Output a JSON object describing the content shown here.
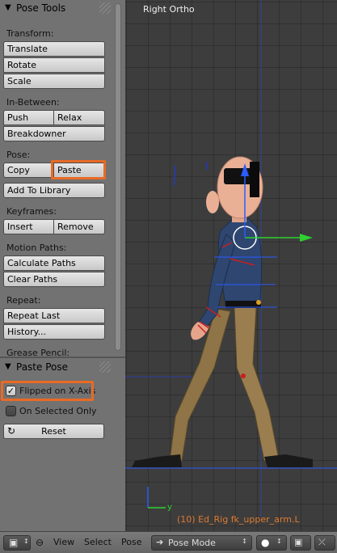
{
  "toolshelf": {
    "title": "Pose Tools",
    "sections": {
      "transform": "Transform:",
      "in_between": "In-Between:",
      "pose": "Pose:",
      "keyframes": "Keyframes:",
      "motion_paths": "Motion Paths:",
      "repeat": "Repeat:",
      "grease_pencil": "Grease Pencil:"
    },
    "buttons": {
      "translate": "Translate",
      "rotate": "Rotate",
      "scale": "Scale",
      "push": "Push",
      "relax": "Relax",
      "breakdowner": "Breakdowner",
      "copy": "Copy",
      "paste": "Paste",
      "add_to_library": "Add To Library",
      "insert": "Insert",
      "remove": "Remove",
      "calculate_paths": "Calculate Paths",
      "clear_paths": "Clear Paths",
      "repeat_last": "Repeat Last",
      "history": "History..."
    }
  },
  "paste_pose": {
    "title": "Paste Pose",
    "flipped_label": "Flipped on X-Axis",
    "flipped_checked": true,
    "on_selected_label": "On Selected Only",
    "on_selected_checked": false,
    "reset_label": "Reset"
  },
  "viewport": {
    "title": "Right Ortho",
    "status": "(10) Ed_Rig fk_upper_arm.L",
    "axis_y": "y"
  },
  "header": {
    "menu_view": "View",
    "menu_select": "Select",
    "menu_pose": "Pose",
    "mode": "Pose Mode"
  },
  "colors": {
    "highlight": "#ea6a24",
    "status_text": "#e07a2e",
    "gizmo_green": "#2fd22f",
    "gizmo_blue": "#2a5cff"
  }
}
